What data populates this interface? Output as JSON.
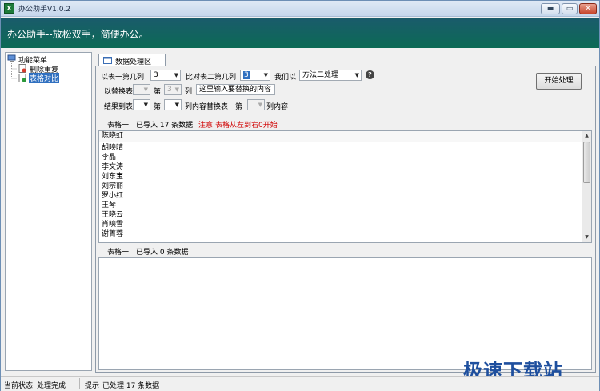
{
  "window": {
    "title": "办公助手V1.0.2",
    "app_icon": "X",
    "banner": "办公助手--放松双手，简便办公。"
  },
  "window_buttons": {
    "minimize": "▬",
    "restore": "▭",
    "close": "✕"
  },
  "tree": {
    "root": "功能菜单",
    "items": [
      "删除重复",
      "表格对比"
    ]
  },
  "tab": {
    "label": "数据处理区"
  },
  "form": {
    "row1": {
      "label1": "以表一第几列",
      "value1": "3",
      "label2": "比对表二第几列",
      "value2": "3",
      "label3": "我们以",
      "method": "方法二处理",
      "help": "?"
    },
    "row2": {
      "label1": "以替换表",
      "value1": "",
      "label2": "第",
      "value2": "3",
      "label3": "列",
      "placeholder": "这里输入要替换的内容"
    },
    "row3": {
      "label1": "结果到表",
      "value1": "",
      "label2": "第",
      "value2": "",
      "label3": "列内容替换表一第",
      "value3": "",
      "label4": "列内容"
    },
    "start_button": "开始处理"
  },
  "table1": {
    "name": "表格一",
    "imported": "已导入 17 条数据",
    "note": "注意:表格从左到右0开始",
    "header": "陈晓虹",
    "rows": [
      "胡映晴",
      "李晶",
      "李文涛",
      "刘东宝",
      "刘宗丽",
      "罗小红",
      "王琴",
      "王晓云",
      "肖映雪",
      "谢菁蓉"
    ]
  },
  "table2": {
    "name": "表格一",
    "imported": "已导入 0 条数据"
  },
  "statusbar": {
    "state_label": "当前状态",
    "state_value": "处理完成",
    "hint_label": "提示",
    "hint_value": "已处理 17 条数据"
  },
  "watermark": "极速下载站",
  "colors": {
    "banner": "#0f6459",
    "note": "#d00000",
    "watermark": "#1e4f9e"
  }
}
